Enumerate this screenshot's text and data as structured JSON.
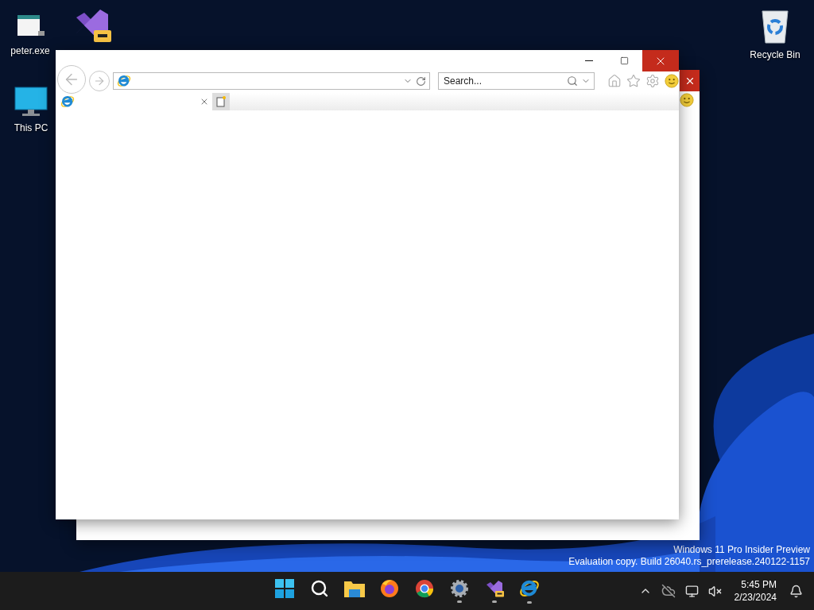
{
  "desktop_icons": [
    {
      "kind": "file",
      "label": "peter.exe"
    },
    {
      "kind": "visual-studio"
    },
    {
      "kind": "pc",
      "label": "This PC"
    },
    {
      "kind": "recycle",
      "label": "Recycle Bin"
    }
  ],
  "browser": {
    "search": {
      "placeholder": "Search..."
    }
  },
  "watermark": [
    "Windows 11 Pro Insider Preview",
    "Evaluation copy. Build 26040.rs_prerelease.240122-1157"
  ],
  "taskbar": {
    "apps": [
      {
        "kind": "start",
        "running": false
      },
      {
        "kind": "search",
        "running": false
      },
      {
        "kind": "explorer",
        "running": false
      },
      {
        "kind": "firefox",
        "running": false
      },
      {
        "kind": "chrome",
        "running": false
      },
      {
        "kind": "settings",
        "running": true
      },
      {
        "kind": "visual-studio",
        "running": true
      },
      {
        "kind": "ie",
        "running": true
      }
    ],
    "clock": {
      "time": "5:45 PM",
      "date": "2/23/2024"
    }
  }
}
